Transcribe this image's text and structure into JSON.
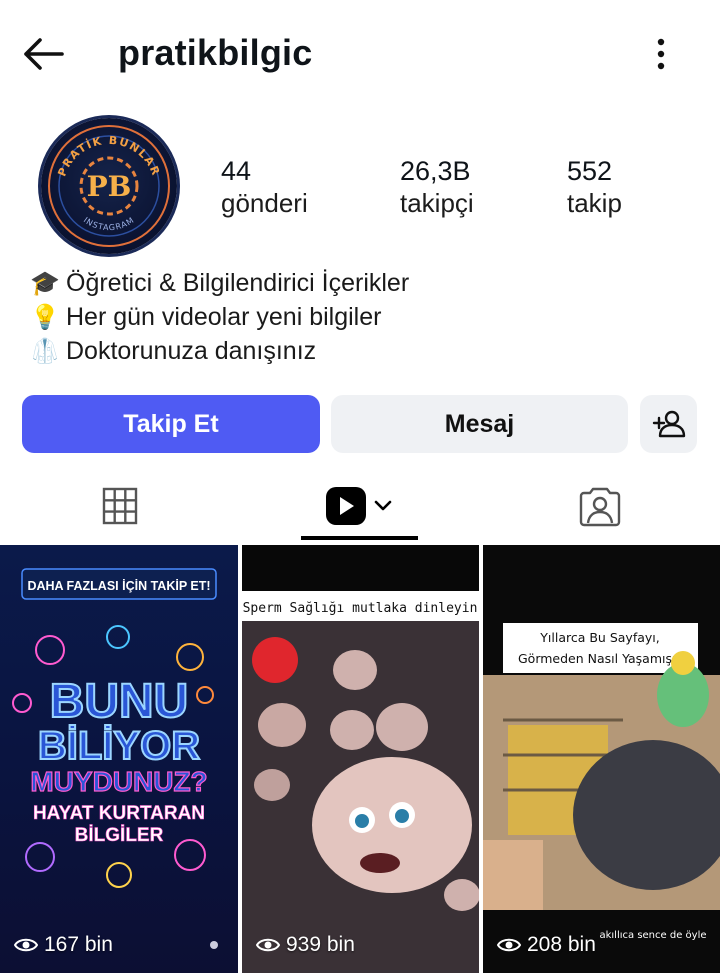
{
  "header": {
    "username": "pratikbilgic"
  },
  "avatar": {
    "ring_top": "PRATİK BUNLAR",
    "ring_bottom": "INSTAGRAM",
    "monogram": "PB"
  },
  "stats": [
    {
      "value": "44",
      "label": "gönderi"
    },
    {
      "value": "26,3B",
      "label": "takipçi"
    },
    {
      "value": "552",
      "label": "takip"
    }
  ],
  "bio": [
    {
      "icon": "🎓",
      "text": "Öğretici & Bilgilendirici İçerikler"
    },
    {
      "icon": "💡",
      "text": "Her gün videolar yeni bilgiler"
    },
    {
      "icon": "🥼",
      "text": "Doktorunuza danışınız"
    }
  ],
  "actions": {
    "follow_label": "Takip Et",
    "message_label": "Mesaj"
  },
  "colors": {
    "follow": "#4f5bf3",
    "button_gray": "#eff1f4"
  },
  "tiles": [
    {
      "banner": "DAHA FAZLASI İÇİN TAKİP ET!",
      "title1": "BUNU",
      "title2": "BİLİYOR",
      "title3": "MUYDUNUZ?",
      "subtitle1": "HAYAT KURTARAN",
      "subtitle2": "BİLGİLER",
      "views": "167 bin"
    },
    {
      "caption": "Sperm Sağlığı mutlaka dinleyin",
      "views": "939 bin"
    },
    {
      "caption1": "Yıllarca Bu Sayfayı,",
      "caption2": "Görmeden Nasıl Yaşamışız",
      "bottom_text": "akıllıca sence de öyle",
      "views": "208 bin"
    }
  ]
}
